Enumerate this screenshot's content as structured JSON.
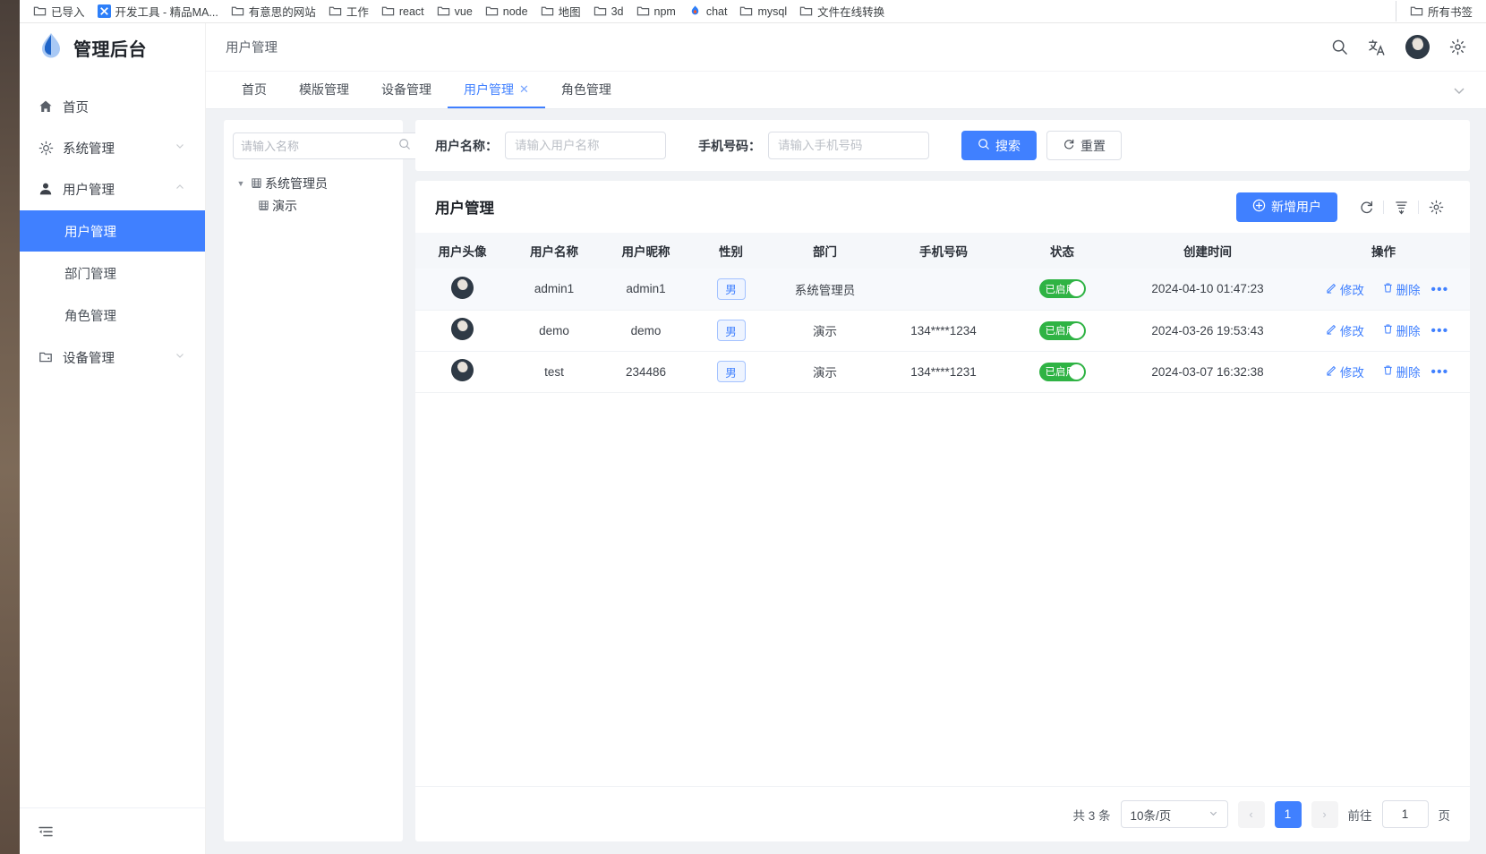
{
  "browser": {
    "bookmarks": [
      {
        "label": "已导入",
        "icon": "folder-icon"
      },
      {
        "label": "开发工具 - 精品MA...",
        "icon": "x-site-icon"
      },
      {
        "label": "有意思的网站",
        "icon": "folder-icon"
      },
      {
        "label": "工作",
        "icon": "folder-icon"
      },
      {
        "label": "react",
        "icon": "folder-icon"
      },
      {
        "label": "vue",
        "icon": "folder-icon"
      },
      {
        "label": "node",
        "icon": "folder-icon"
      },
      {
        "label": "地图",
        "icon": "folder-icon"
      },
      {
        "label": "3d",
        "icon": "folder-icon"
      },
      {
        "label": "npm",
        "icon": "folder-icon"
      },
      {
        "label": "chat",
        "icon": "chat-site-icon"
      },
      {
        "label": "mysql",
        "icon": "folder-icon"
      },
      {
        "label": "文件在线转换",
        "icon": "folder-icon"
      }
    ],
    "all_bookmarks": {
      "label": "所有书签",
      "icon": "folder-icon"
    }
  },
  "sidebar": {
    "logo_text": "管理后台",
    "logo_icon": "droplet-logo-icon",
    "items": [
      {
        "label": "首页",
        "icon": "home-icon",
        "expandable": false
      },
      {
        "label": "系统管理",
        "icon": "gear-icon",
        "expandable": true,
        "expanded": false
      },
      {
        "label": "用户管理",
        "icon": "user-icon",
        "expandable": true,
        "expanded": true
      }
    ],
    "submenu": [
      {
        "label": "用户管理",
        "active": true
      },
      {
        "label": "部门管理",
        "active": false
      },
      {
        "label": "角色管理",
        "active": false
      }
    ],
    "device_item": {
      "label": "设备管理",
      "icon": "folder-device-icon",
      "expandable": true,
      "expanded": false
    },
    "collapse_icon": "collapse-sidebar-icon"
  },
  "topbar": {
    "breadcrumb": "用户管理",
    "icons": [
      "search-icon",
      "translate-icon",
      "avatar",
      "settings-gear-icon"
    ]
  },
  "tabs": {
    "items": [
      {
        "label": "首页",
        "active": false,
        "closable": false
      },
      {
        "label": "模版管理",
        "active": false,
        "closable": false
      },
      {
        "label": "设备管理",
        "active": false,
        "closable": false
      },
      {
        "label": "用户管理",
        "active": true,
        "closable": true
      },
      {
        "label": "角色管理",
        "active": false,
        "closable": false
      }
    ],
    "close_glyph": "✕",
    "more_icon": "chevron-down-icon"
  },
  "tree": {
    "search_placeholder": "请输入名称",
    "search_value": "",
    "search_icon": "search-icon",
    "more_icon": "more-vertical-icon",
    "nodes": [
      {
        "label": "系统管理员",
        "level": 0,
        "expanded": true
      },
      {
        "label": "演示",
        "level": 1,
        "expanded": false
      }
    ]
  },
  "filter": {
    "username_label": "用户名称：",
    "username_placeholder": "请输入用户名称",
    "username_value": "",
    "phone_label": "手机号码：",
    "phone_placeholder": "请输入手机号码",
    "phone_value": "",
    "search_button": "搜索",
    "search_icon": "search-icon",
    "reset_button": "重置",
    "reset_icon": "refresh-icon"
  },
  "table": {
    "title": "用户管理",
    "add_button": "新增用户",
    "add_icon": "plus-circle-icon",
    "tool_icons": [
      "refresh-icon",
      "density-icon",
      "column-settings-gear-icon"
    ],
    "columns": [
      "用户头像",
      "用户名称",
      "用户昵称",
      "性别",
      "部门",
      "手机号码",
      "状态",
      "创建时间",
      "操作"
    ],
    "rows": [
      {
        "avatar": "user-avatar",
        "username": "admin1",
        "nickname": "admin1",
        "gender": "男",
        "department": "系统管理员",
        "phone": "",
        "status": "已启用",
        "created_at": "2024-04-10 01:47:23"
      },
      {
        "avatar": "user-avatar",
        "username": "demo",
        "nickname": "demo",
        "gender": "男",
        "department": "演示",
        "phone": "134****1234",
        "status": "已启用",
        "created_at": "2024-03-26 19:53:43"
      },
      {
        "avatar": "user-avatar",
        "username": "test",
        "nickname": "234486",
        "gender": "男",
        "department": "演示",
        "phone": "134****1231",
        "status": "已启用",
        "created_at": "2024-03-07 16:32:38"
      }
    ],
    "actions": {
      "edit_label": "修改",
      "edit_icon": "pencil-icon",
      "delete_label": "删除",
      "delete_icon": "trash-icon",
      "more_glyph": "•••"
    }
  },
  "pagination": {
    "total_text": "共 3 条",
    "page_size": "10条/页",
    "prev_glyph": "‹",
    "next_glyph": "›",
    "pages": [
      "1"
    ],
    "current_page": "1",
    "jump_label": "前往",
    "jump_value": "1",
    "jump_unit": "页"
  },
  "colors": {
    "primary": "#4080ff",
    "success": "#2fb344",
    "page_bg": "#f0f2f5",
    "card_bg": "#ffffff"
  }
}
